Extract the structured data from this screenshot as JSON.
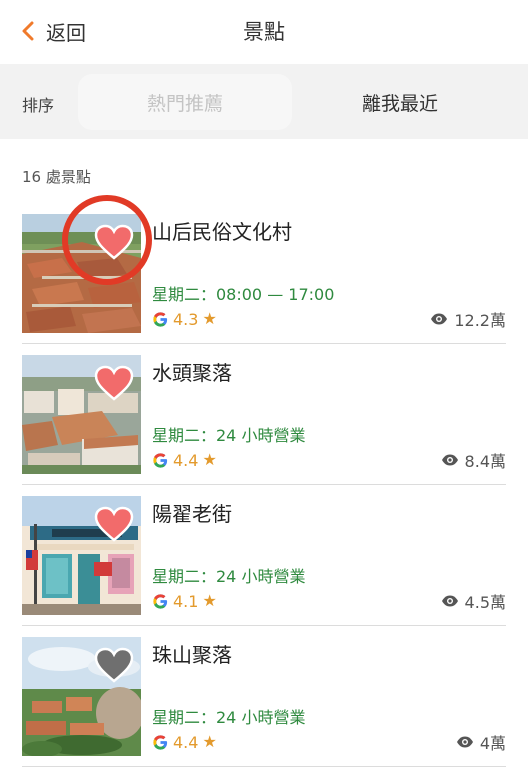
{
  "header": {
    "back_label": "返回",
    "title": "景點",
    "back_icon": "chevron-left-icon",
    "accent": "#f07a2b"
  },
  "sort": {
    "label": "排序",
    "tabs": [
      "熱門推薦",
      "離我最近"
    ],
    "selected": "熱門推薦"
  },
  "count_text": "16 處景點",
  "items": [
    {
      "name": "山后民俗文化村",
      "hours": "星期二：08:00 — 17:00",
      "rating": "4.3",
      "views": "12.2萬",
      "favorited": true
    },
    {
      "name": "水頭聚落",
      "hours": "星期二：24 小時營業",
      "rating": "4.4",
      "views": "8.4萬",
      "favorited": true
    },
    {
      "name": "陽翟老街",
      "hours": "星期二：24 小時營業",
      "rating": "4.1",
      "views": "4.5萬",
      "favorited": true
    },
    {
      "name": "珠山聚落",
      "hours": "星期二：24 小時營業",
      "rating": "4.4",
      "views": "4萬",
      "favorited": false
    }
  ],
  "colors": {
    "heart_active": "#f26b6b",
    "heart_inactive": "#6f6f6f",
    "hours_green": "#2f8a3f",
    "rating_orange": "#e39a2d",
    "highlight_circle": "#e13a26"
  }
}
